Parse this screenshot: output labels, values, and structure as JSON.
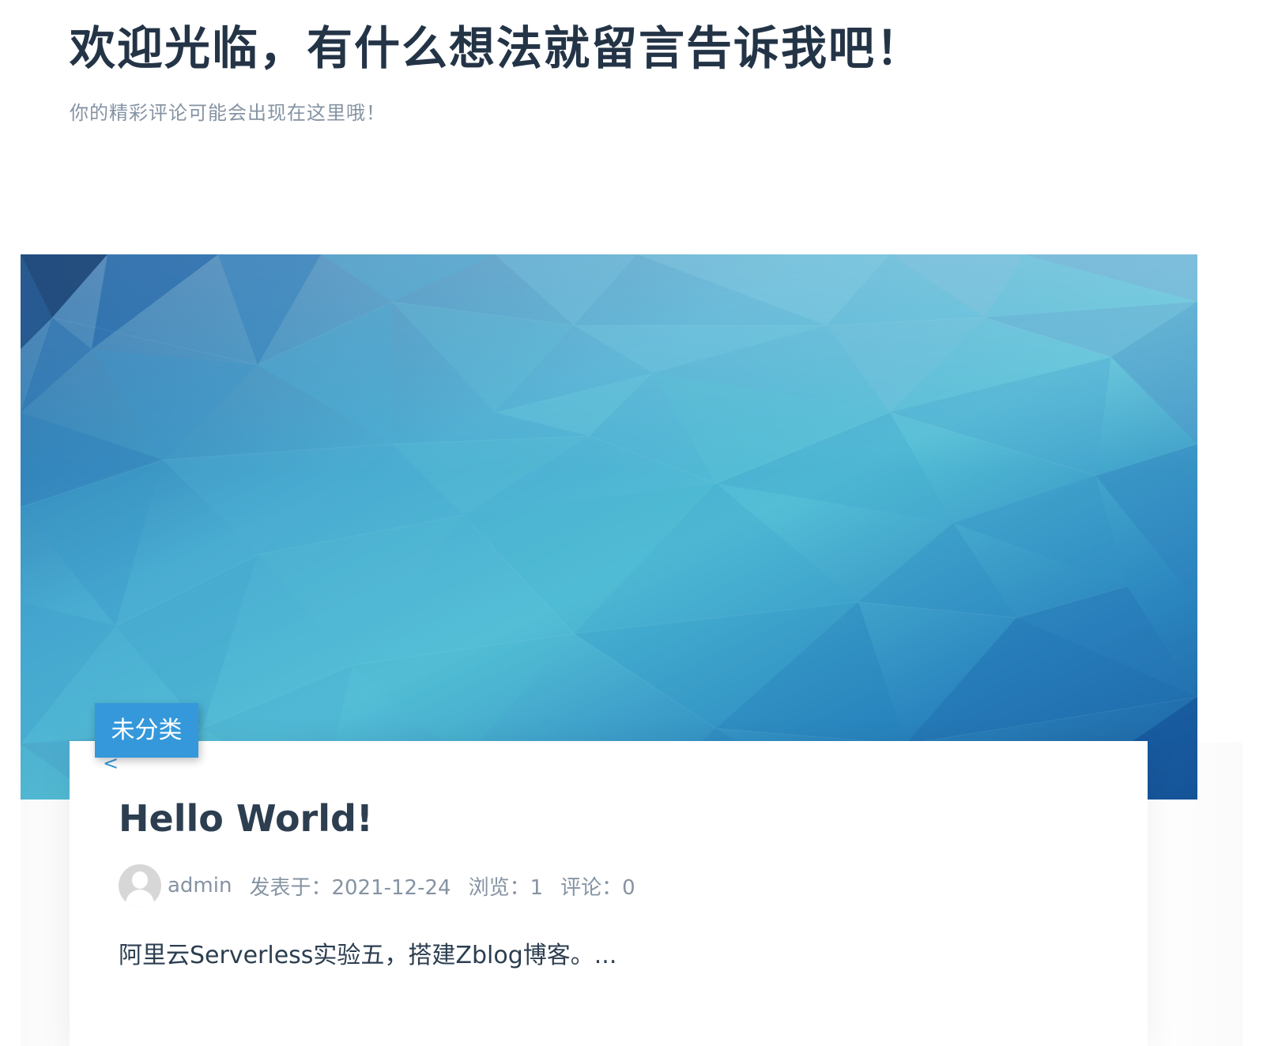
{
  "site": {
    "title": "欢迎光临，有什么想法就留言告诉我吧！",
    "subtitle": "你的精彩评论可能会出现在这里哦！"
  },
  "post": {
    "category": "未分类",
    "title": "Hello World!",
    "author": "admin",
    "published": "发表于：2021-12-24",
    "views": "浏览：1",
    "comments": "评论：0",
    "excerpt": "阿里云Serverless实验五，搭建Zblog博客。..."
  },
  "colors": {
    "accent": "#3498db",
    "title_text": "#2c3e50",
    "muted_text": "#8593a3",
    "banner_base": "#3d9fcb"
  }
}
